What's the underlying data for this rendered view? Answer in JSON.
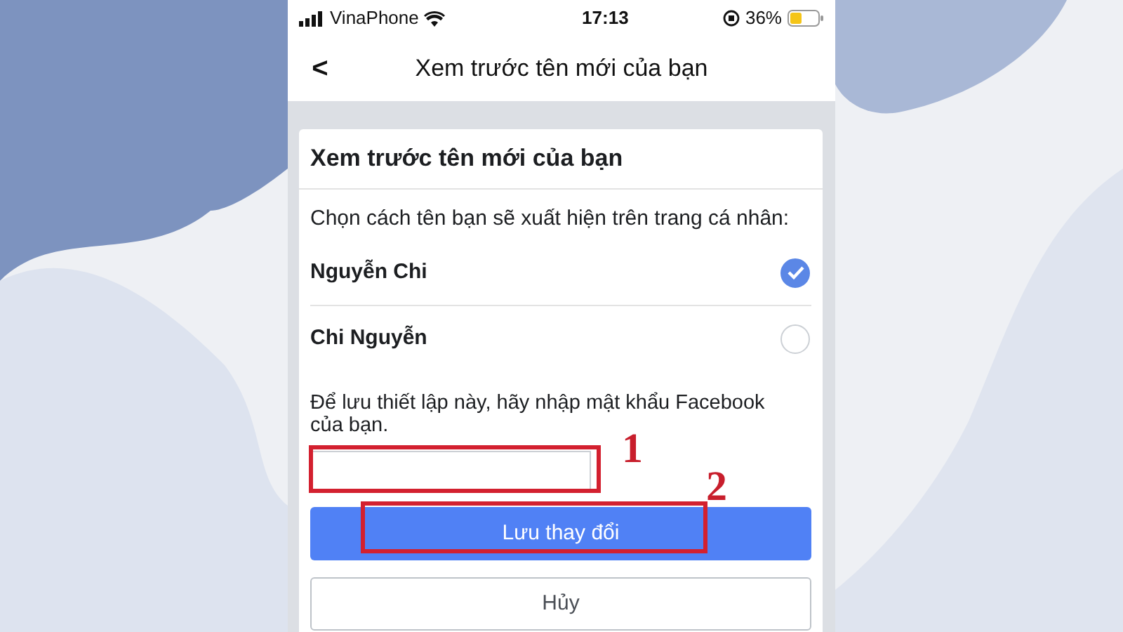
{
  "status_bar": {
    "carrier": "VinaPhone",
    "time": "17:13",
    "battery": "36%"
  },
  "nav": {
    "back": "<",
    "title": "Xem trước tên mới của bạn"
  },
  "card": {
    "title": "Xem trước tên mới của bạn",
    "prompt": "Chọn cách tên bạn sẽ xuất hiện trên trang cá nhân:",
    "options": [
      {
        "label": "Nguyễn Chi",
        "selected": true
      },
      {
        "label": "Chi Nguyễn",
        "selected": false
      }
    ],
    "password_prompt": "Để lưu thiết lập này, hãy nhập mật khẩu Facebook của bạn.",
    "buttons": [
      {
        "label": "Lưu thay đổi",
        "kind": "primary"
      },
      {
        "label": "Hủy",
        "kind": "secondary"
      }
    ]
  },
  "annotations": [
    {
      "label": "1"
    },
    {
      "label": "2"
    }
  ]
}
